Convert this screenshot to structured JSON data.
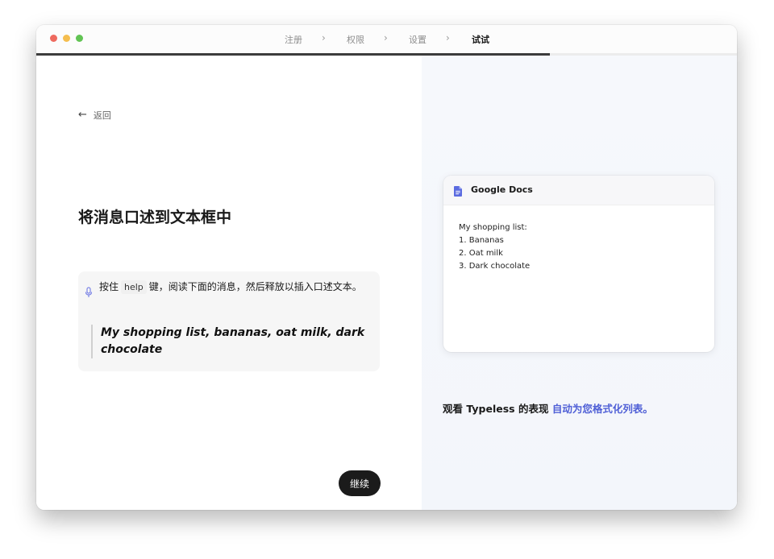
{
  "window": {
    "steps": [
      "注册",
      "权限",
      "设置",
      "试试"
    ],
    "active_step_index": 3,
    "progress_fraction": 0.733
  },
  "left": {
    "back_label": "返回",
    "heading": "将消息口述到文本框中",
    "instruction": {
      "prefix": "按住",
      "key": "help",
      "suffix": "键，阅读下面的消息，然后释放以插入口述文本。"
    },
    "quote": "My shopping list, bananas, oat milk, dark chocolate",
    "continue_label": "继续"
  },
  "right": {
    "doc_app": "Google Docs",
    "doc_lines": [
      "My shopping list:",
      "1. Bananas",
      "2. Oat milk",
      "3. Dark chocolate"
    ],
    "caption_prefix": "观看 Typeless 的表现",
    "caption_link": "自动为您格式化列表。"
  },
  "colors": {
    "accent": "#4f5fd6",
    "traffic_red": "#ee6a5f",
    "traffic_yellow": "#f5be4f",
    "traffic_green": "#62c454",
    "button_bg": "#1b1b1b"
  },
  "icons": {
    "back": "arrow-left-icon",
    "mic": "microphone-icon",
    "doc": "document-icon"
  }
}
